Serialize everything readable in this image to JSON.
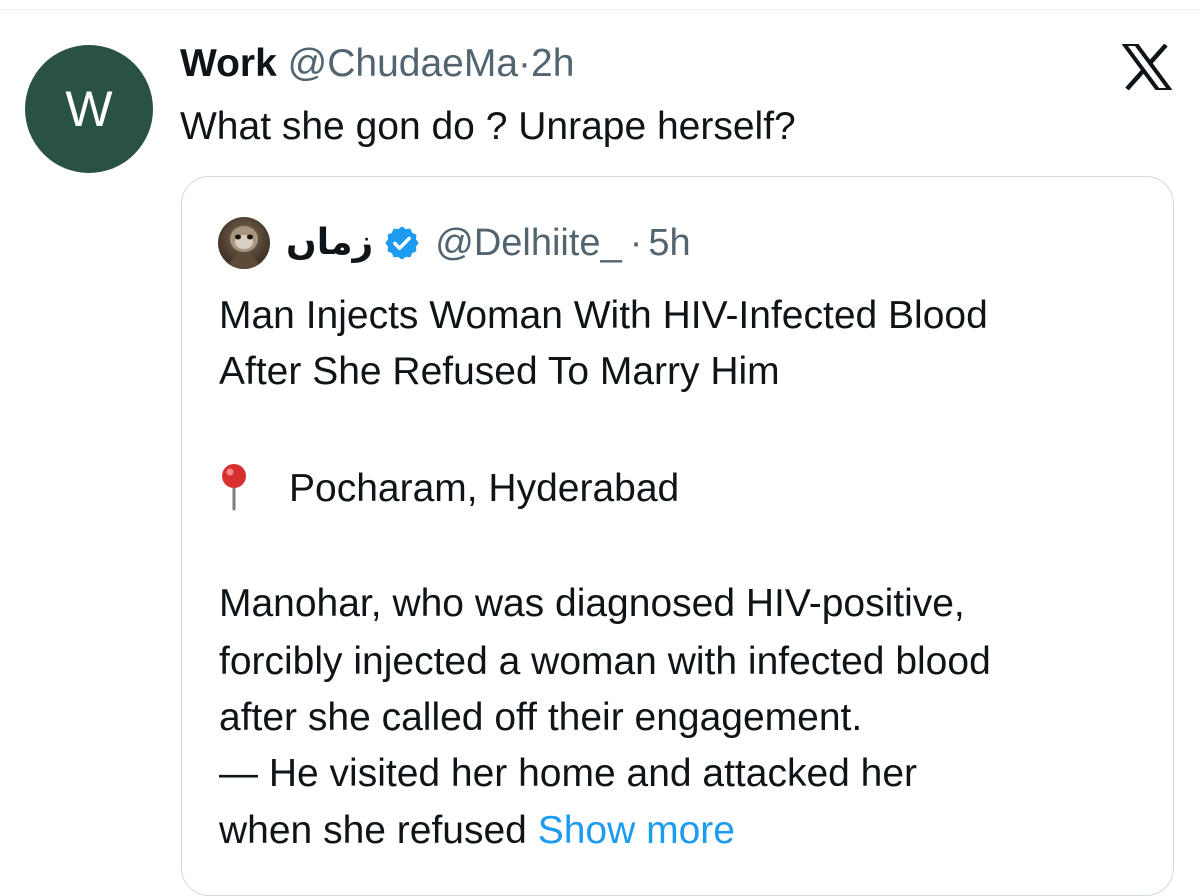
{
  "tweet": {
    "avatar_letter": "W",
    "avatar_color": "#295244",
    "author_name": "Work",
    "handle": "@ChudaeMa",
    "separator": "·",
    "time": "2h",
    "text": "What she gon do ? Unrape herself?"
  },
  "quoted": {
    "author_name": "زماں",
    "verified_icon": "verified-badge-icon",
    "handle": "@Delhiite_",
    "separator": "·",
    "time": "5h",
    "headline_line1": "Man Injects Woman With HIV-Infected Blood",
    "headline_line2": "After She Refused To Marry Him",
    "location_icon": "round-pushpin-icon",
    "location": "Pocharam, Hyderabad",
    "body_line1": "Manohar, who was diagnosed HIV-positive,",
    "body_line2": "forcibly injected a woman with infected blood",
    "body_line3": "after she called off their engagement.",
    "body_line4": "— He visited her home and attacked her",
    "body_line5": "when she refused",
    "show_more": "Show more"
  },
  "colors": {
    "text": "#0f1419",
    "muted": "#536471",
    "link": "#1d9bf0",
    "border": "#cfd9de"
  }
}
